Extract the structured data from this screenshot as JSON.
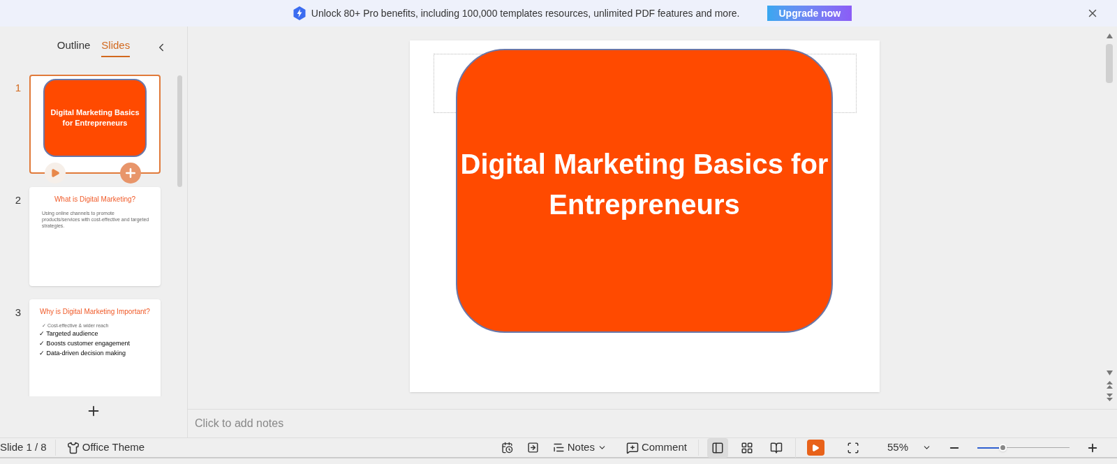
{
  "banner": {
    "text": "Unlock 80+ Pro benefits, including 100,000 templates resources, unlimited PDF features and more.",
    "button": "Upgrade now"
  },
  "panel_tabs": [
    {
      "label": "Outline",
      "selected": false
    },
    {
      "label": "Slides",
      "selected": true
    }
  ],
  "slides": [
    {
      "number": "1",
      "selected": true,
      "kind": "title",
      "title": "Digital Marketing Basics for Entrepreneurs"
    },
    {
      "number": "2",
      "selected": false,
      "kind": "bullets",
      "title": "What is Digital Marketing?",
      "bullets": [
        {
          "text": "Using online channels to promote products/services with cost-effective and targeted strategies.",
          "small": true
        }
      ]
    },
    {
      "number": "3",
      "selected": false,
      "kind": "bullets",
      "title": "Why is Digital Marketing Important?",
      "bullets": [
        {
          "text": "✓ Cost-effective & wider reach",
          "small": true
        },
        {
          "text": "✓ Targeted audience",
          "small": false
        },
        {
          "text": "✓ Boosts customer engagement",
          "small": false
        },
        {
          "text": "✓ Data-driven decision making",
          "small": false
        }
      ]
    }
  ],
  "editor": {
    "title": "Digital Marketing Basics for Entrepreneurs"
  },
  "notes": {
    "placeholder": "Click to add notes"
  },
  "status_bar": {
    "slide_counter": "Slide 1 / 8",
    "theme": "Office Theme",
    "notes": "Notes",
    "comment": "Comment",
    "views": [
      {
        "kind": "normal",
        "selected": true
      },
      {
        "kind": "sorter",
        "selected": false
      },
      {
        "kind": "reading",
        "selected": false
      }
    ],
    "zoom": "55%",
    "zoom_slider": {
      "level": 0.27
    }
  }
}
